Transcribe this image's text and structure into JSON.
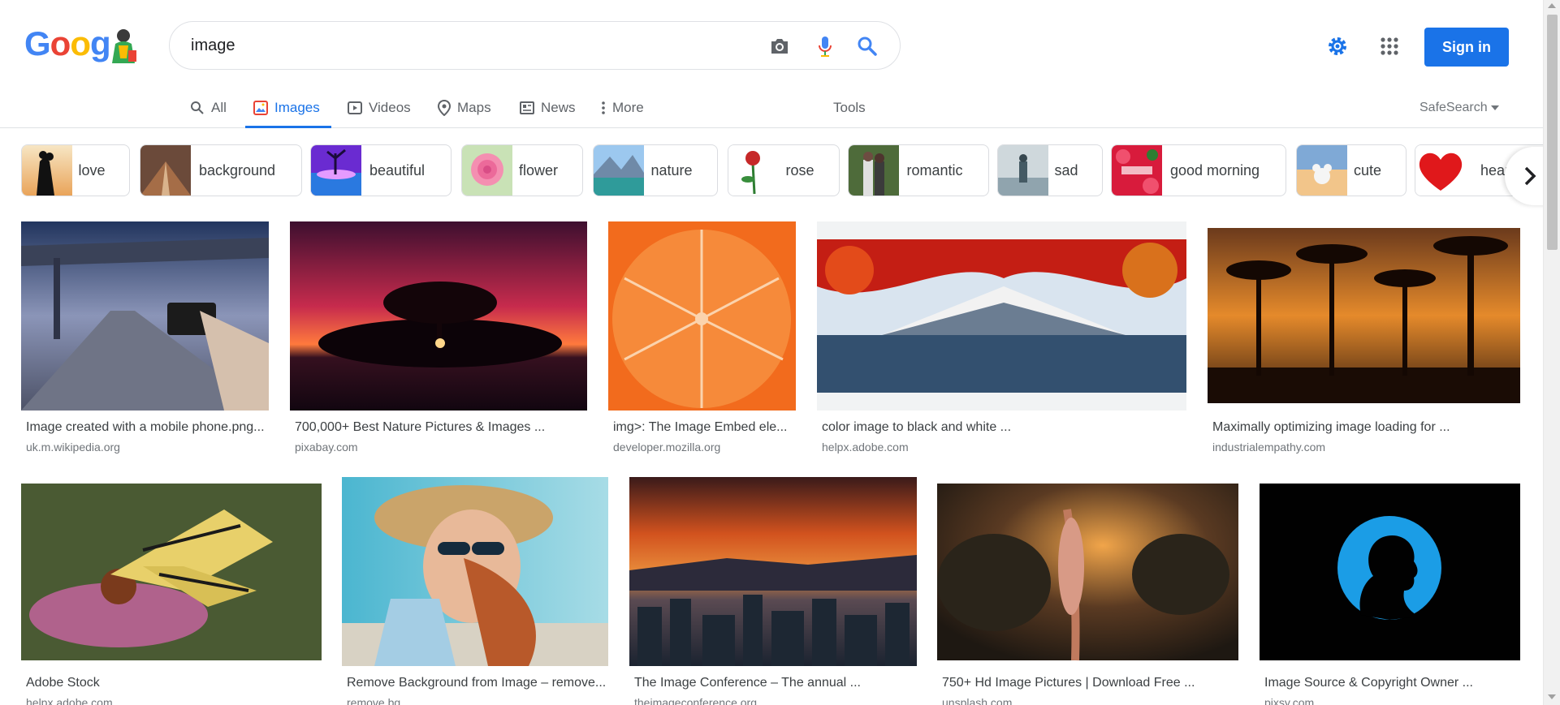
{
  "logo": {
    "letters": [
      "G",
      "o",
      "o",
      "g"
    ]
  },
  "search": {
    "value": "image"
  },
  "header": {
    "sign_in": "Sign in"
  },
  "tabs": [
    {
      "label": "All",
      "icon": "search-icon"
    },
    {
      "label": "Images",
      "icon": "image-icon"
    },
    {
      "label": "Videos",
      "icon": "video-icon"
    },
    {
      "label": "Maps",
      "icon": "map-pin-icon"
    },
    {
      "label": "News",
      "icon": "news-icon"
    },
    {
      "label": "More",
      "icon": "more-vert-icon"
    }
  ],
  "tools": "Tools",
  "safesearch": "SafeSearch",
  "chips": [
    {
      "label": "love"
    },
    {
      "label": "background"
    },
    {
      "label": "beautiful"
    },
    {
      "label": "flower"
    },
    {
      "label": "nature"
    },
    {
      "label": "rose"
    },
    {
      "label": "romantic"
    },
    {
      "label": "sad"
    },
    {
      "label": "good morning"
    },
    {
      "label": "cute"
    },
    {
      "label": "heart"
    }
  ],
  "results": [
    {
      "title": "Image created with a mobile phone.png...",
      "site": "uk.m.wikipedia.org"
    },
    {
      "title": "700,000+ Best Nature Pictures & Images ...",
      "site": "pixabay.com"
    },
    {
      "title": "img>: The Image Embed ele...",
      "site": "developer.mozilla.org"
    },
    {
      "title": "color image to black and white ...",
      "site": "helpx.adobe.com"
    },
    {
      "title": "Maximally optimizing image loading for ...",
      "site": "industrialempathy.com"
    },
    {
      "title": "Adobe Stock",
      "site": "helpx.adobe.com"
    },
    {
      "title": "Remove Background from Image – remove...",
      "site": "remove.bg"
    },
    {
      "title": "The Image Conference – The annual ...",
      "site": "theimageconference.org"
    },
    {
      "title": "750+ Hd Image Pictures | Download Free ...",
      "site": "unsplash.com"
    },
    {
      "title": "Image Source & Copyright Owner ...",
      "site": "pixsy.com"
    }
  ],
  "colors": {
    "accent": "#1a73e8",
    "text": "#202124",
    "muted": "#70757a"
  }
}
